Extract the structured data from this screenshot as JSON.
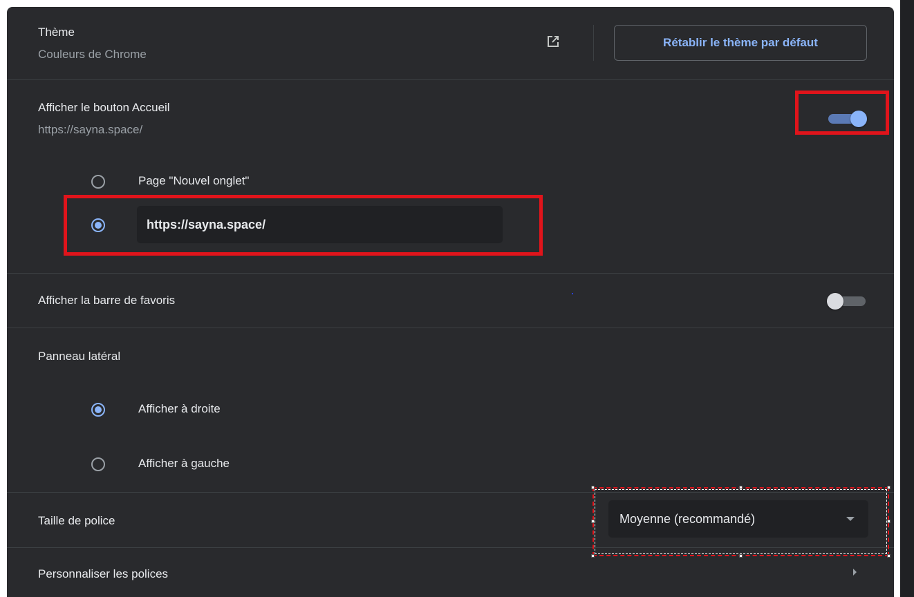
{
  "theme": {
    "title": "Thème",
    "subtitle": "Couleurs de Chrome",
    "icon": "open-in-new-icon",
    "reset_button": "Rétablir le thème par défaut"
  },
  "home_button": {
    "title": "Afficher le bouton Accueil",
    "subtitle": "https://sayna.space/",
    "enabled": true,
    "options": [
      {
        "label": "Page \"Nouvel onglet\"",
        "selected": false
      },
      {
        "value": "https://sayna.space/",
        "selected": true
      }
    ]
  },
  "bookmarks_bar": {
    "title": "Afficher la barre de favoris",
    "enabled": false
  },
  "side_panel": {
    "title": "Panneau latéral",
    "options": [
      {
        "label": "Afficher à droite",
        "selected": true
      },
      {
        "label": "Afficher à gauche",
        "selected": false
      }
    ]
  },
  "font_size": {
    "title": "Taille de police",
    "selected": "Moyenne (recommandé)"
  },
  "customize_fonts": {
    "title": "Personnaliser les polices",
    "icon": "chevron-right-icon"
  },
  "colors": {
    "card_background": "#292a2d",
    "accent": "#8ab4f8",
    "highlight_red": "#e0141b"
  }
}
